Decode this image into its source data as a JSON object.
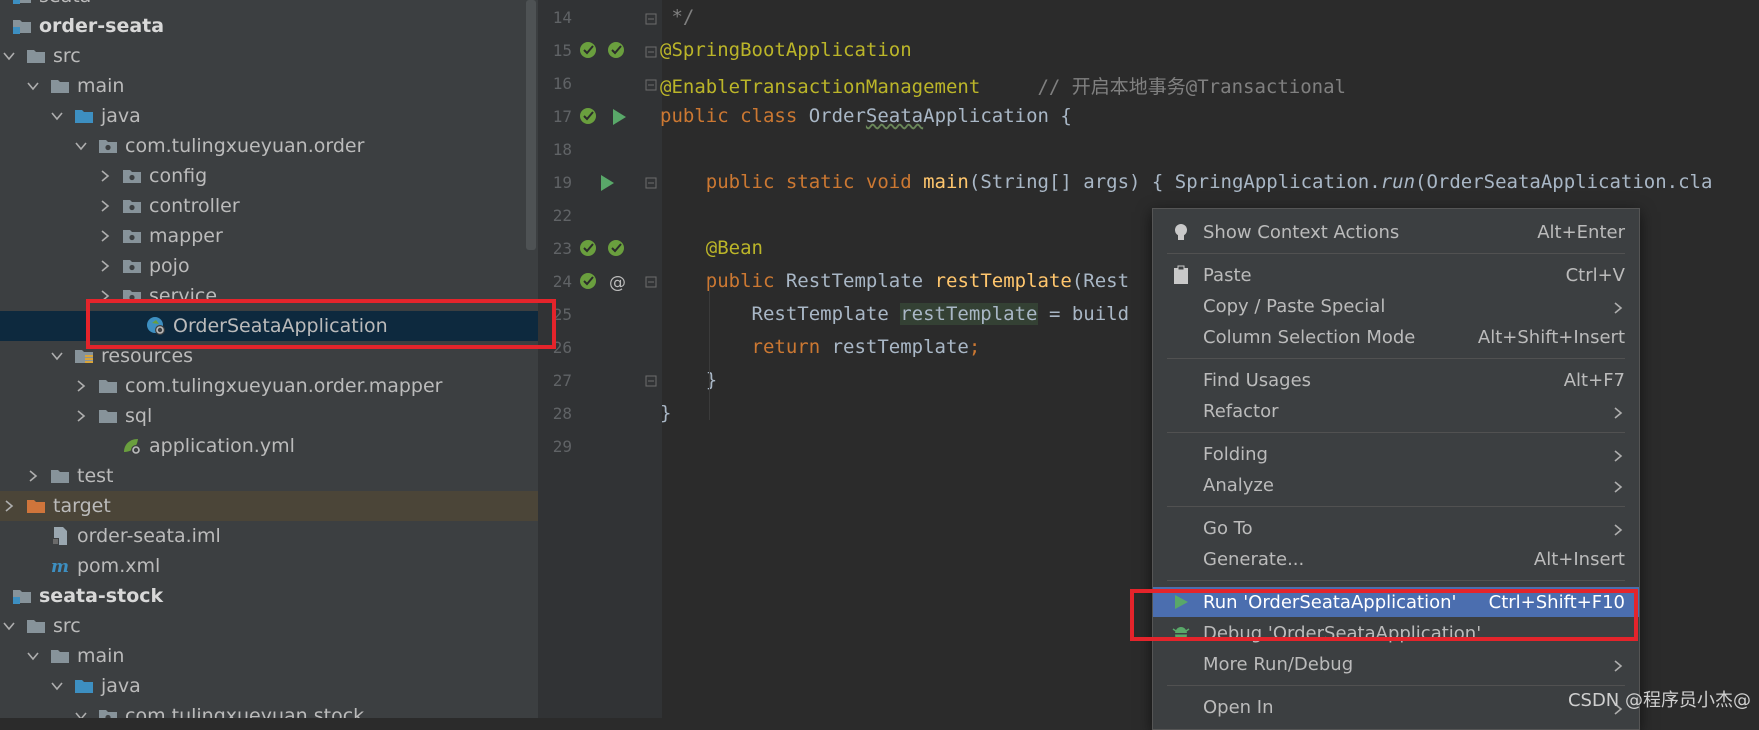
{
  "tree": {
    "items": [
      {
        "label": "seata",
        "depth": 0,
        "arrow": "none",
        "icon": "module-icon"
      },
      {
        "label": "order-seata",
        "depth": 0,
        "arrow": "none",
        "icon": "module-icon",
        "bold": true
      },
      {
        "label": "src",
        "depth": 0,
        "arrow": "down",
        "icon": "folder-icon"
      },
      {
        "label": "main",
        "depth": 1,
        "arrow": "down",
        "icon": "folder-icon"
      },
      {
        "label": "java",
        "depth": 2,
        "arrow": "down",
        "icon": "source-folder-icon"
      },
      {
        "label": "com.tulingxueyuan.order",
        "depth": 3,
        "arrow": "down",
        "icon": "package-icon"
      },
      {
        "label": "config",
        "depth": 4,
        "arrow": "right",
        "icon": "package-icon"
      },
      {
        "label": "controller",
        "depth": 4,
        "arrow": "right",
        "icon": "package-icon"
      },
      {
        "label": "mapper",
        "depth": 4,
        "arrow": "right",
        "icon": "package-icon"
      },
      {
        "label": "pojo",
        "depth": 4,
        "arrow": "right",
        "icon": "package-icon"
      },
      {
        "label": "service",
        "depth": 4,
        "arrow": "right",
        "icon": "package-icon"
      },
      {
        "label": "OrderSeataApplication",
        "depth": 5,
        "arrow": "none",
        "icon": "spring-boot-class-icon",
        "selected": true
      },
      {
        "label": "resources",
        "depth": 2,
        "arrow": "down",
        "icon": "resources-folder-icon"
      },
      {
        "label": "com.tulingxueyuan.order.mapper",
        "depth": 3,
        "arrow": "right",
        "icon": "folder-icon"
      },
      {
        "label": "sql",
        "depth": 3,
        "arrow": "right",
        "icon": "folder-icon"
      },
      {
        "label": "application.yml",
        "depth": 4,
        "arrow": "none",
        "icon": "spring-yml-icon"
      },
      {
        "label": "test",
        "depth": 1,
        "arrow": "right",
        "icon": "folder-icon"
      },
      {
        "label": "target",
        "depth": 0,
        "arrow": "right",
        "icon": "excluded-folder-icon",
        "target": true
      },
      {
        "label": "order-seata.iml",
        "depth": 1,
        "arrow": "none",
        "icon": "iml-file-icon"
      },
      {
        "label": "pom.xml",
        "depth": 1,
        "arrow": "none",
        "icon": "maven-icon"
      },
      {
        "label": "seata-stock",
        "depth": 0,
        "arrow": "none",
        "icon": "module-icon",
        "bold": true
      },
      {
        "label": "src",
        "depth": 0,
        "arrow": "down",
        "icon": "folder-icon"
      },
      {
        "label": "main",
        "depth": 1,
        "arrow": "down",
        "icon": "folder-icon"
      },
      {
        "label": "java",
        "depth": 2,
        "arrow": "down",
        "icon": "source-folder-icon"
      },
      {
        "label": "com.tulingxueyuan.stock",
        "depth": 3,
        "arrow": "down",
        "icon": "package-icon"
      }
    ]
  },
  "editor": {
    "line_numbers": [
      "14",
      "15",
      "16",
      "17",
      "18",
      "19",
      "22",
      "23",
      "24",
      "25",
      "26",
      "27",
      "28",
      "29"
    ],
    "lines": [
      [
        {
          "t": " */",
          "c": "cm"
        }
      ],
      [
        {
          "t": "@SpringBootApplication",
          "c": "ann"
        }
      ],
      [
        {
          "t": "@EnableTransactionManagement",
          "c": "ann"
        },
        {
          "t": "     // 开启本地事务@Transactional",
          "c": "cm"
        }
      ],
      [
        {
          "t": "public class ",
          "c": "kw"
        },
        {
          "t": "Order",
          "c": ""
        },
        {
          "t": "Seata",
          "c": "squig"
        },
        {
          "t": "Application {",
          "c": ""
        }
      ],
      [],
      [
        {
          "t": "    public static void ",
          "c": "kw"
        },
        {
          "t": "main",
          "c": "fn"
        },
        {
          "t": "(String[] args) { SpringApplication.",
          "c": ""
        },
        {
          "t": "run",
          "c": "it"
        },
        {
          "t": "(OrderSeataApplication.cla",
          "c": ""
        }
      ],
      [],
      [
        {
          "t": "    @Bean",
          "c": "ann"
        }
      ],
      [
        {
          "t": "    public ",
          "c": "kw"
        },
        {
          "t": "RestTemplate ",
          "c": ""
        },
        {
          "t": "restTemplate",
          "c": "fn"
        },
        {
          "t": "(Rest",
          "c": ""
        }
      ],
      [
        {
          "t": "        RestTemplate ",
          "c": ""
        },
        {
          "t": "restTemplate",
          "c": "hl"
        },
        {
          "t": " = build",
          "c": ""
        }
      ],
      [
        {
          "t": "        return ",
          "c": "kw"
        },
        {
          "t": "restTemplate",
          "c": ""
        },
        {
          "t": ";",
          "c": "kw"
        }
      ],
      [
        {
          "t": "    }",
          "c": ""
        }
      ],
      [
        {
          "t": "}",
          "c": ""
        }
      ],
      []
    ]
  },
  "menu": {
    "items": [
      {
        "label": "Show Context Actions",
        "shortcut": "Alt+Enter",
        "icon": "bulb-icon"
      },
      {
        "sep": true
      },
      {
        "label": "Paste",
        "shortcut": "Ctrl+V",
        "icon": "clipboard-icon"
      },
      {
        "label": "Copy / Paste Special",
        "submenu": true
      },
      {
        "label": "Column Selection Mode",
        "shortcut": "Alt+Shift+Insert"
      },
      {
        "sep": true
      },
      {
        "label": "Find Usages",
        "shortcut": "Alt+F7"
      },
      {
        "label": "Refactor",
        "submenu": true
      },
      {
        "sep": true
      },
      {
        "label": "Folding",
        "submenu": true
      },
      {
        "label": "Analyze",
        "submenu": true
      },
      {
        "sep": true
      },
      {
        "label": "Go To",
        "submenu": true
      },
      {
        "label": "Generate...",
        "shortcut": "Alt+Insert"
      },
      {
        "sep": true
      },
      {
        "label": "Run 'OrderSeataApplication'",
        "shortcut": "Ctrl+Shift+F10",
        "icon": "run-icon",
        "active": true
      },
      {
        "label": "Debug 'OrderSeataApplication'",
        "icon": "debug-icon"
      },
      {
        "label": "More Run/Debug",
        "submenu": true
      },
      {
        "sep": true
      },
      {
        "label": "Open In",
        "submenu": true
      }
    ]
  },
  "watermark": "CSDN @程序员小杰@",
  "colors": {
    "highlight": "#e4242b",
    "menu_active": "#4b6eaf"
  }
}
